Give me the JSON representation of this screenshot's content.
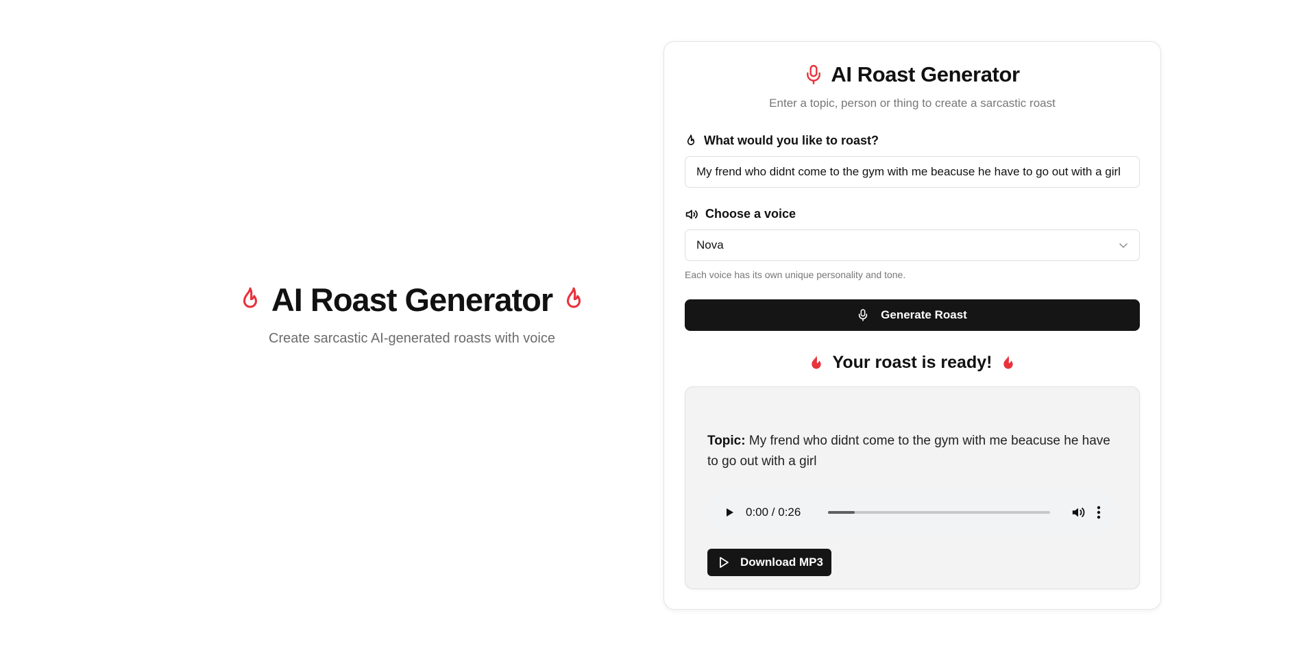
{
  "hero": {
    "title": "AI Roast Generator",
    "subtitle": "Create sarcastic AI-generated roasts with voice"
  },
  "card": {
    "title": "AI Roast Generator",
    "subtitle": "Enter a topic, person or thing to create a sarcastic roast",
    "roast_label": "What would you like to roast?",
    "roast_value": "My frend who didnt come to the gym with me beacuse he have to go out with a girl",
    "voice_label": "Choose a voice",
    "voice_selected": "Nova",
    "voice_hint": "Each voice has its own unique personality and tone.",
    "generate_label": "Generate Roast"
  },
  "result": {
    "heading": "Your roast is ready!",
    "topic_label": "Topic:",
    "topic_text": " My frend who didnt come to the gym with me beacuse he have to go out with a girl",
    "audio_time": "0:00 / 0:26",
    "audio_progress": 0.12,
    "download_label": "Download MP3"
  },
  "colors": {
    "accent": "#e8323c",
    "button_bg": "#151515"
  },
  "icons": {
    "hero_left": "flame-outline-icon",
    "hero_right": "flame-outline-icon",
    "card_title": "microphone-icon",
    "roast_label": "flame-outline-icon",
    "voice_label": "speaker-icon",
    "select_chevron": "chevron-down-icon",
    "generate": "microphone-icon",
    "ready": "flame-filled-icon",
    "play": "play-icon",
    "volume": "volume-icon",
    "more": "more-vertical-icon",
    "download": "play-outline-icon"
  }
}
